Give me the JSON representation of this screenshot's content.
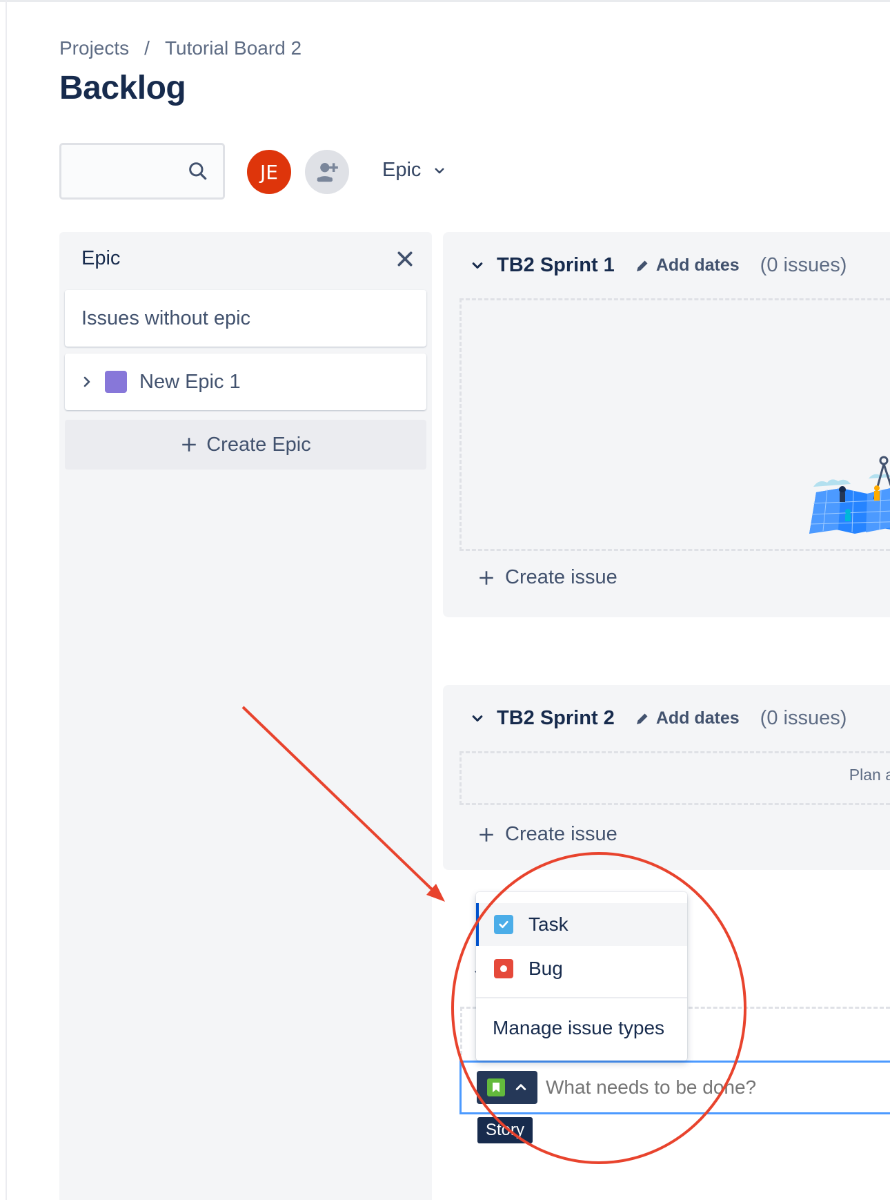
{
  "breadcrumb": {
    "items": [
      "Projects",
      "Tutorial Board 2"
    ],
    "separator": "/"
  },
  "page": {
    "title": "Backlog"
  },
  "toolbar": {
    "search_placeholder": "",
    "avatar_initials": "JE",
    "avatar_color": "#de350b",
    "add_people_icon": "add-user-icon",
    "filter_label": "Epic"
  },
  "epic_panel": {
    "title": "Epic",
    "issues_without_epic": "Issues without epic",
    "epics": [
      {
        "label": "New Epic 1",
        "color": "#8777d9"
      }
    ],
    "create_label": "Create Epic"
  },
  "sprints": [
    {
      "name": "TB2 Sprint 1",
      "add_dates": "Add dates",
      "count": "(0 issues)",
      "create_issue": "Create issue"
    },
    {
      "name": "TB2 Sprint 2",
      "add_dates": "Add dates",
      "count": "(0 issues)",
      "plan_text": "Plan a",
      "create_issue": "Create issue"
    }
  ],
  "issue_type_menu": {
    "items": [
      {
        "label": "Task",
        "icon": "task-checkbox-icon",
        "color": "#4bade8",
        "selected": true
      },
      {
        "label": "Bug",
        "icon": "bug-icon",
        "color": "#e5493a"
      }
    ],
    "manage_label": "Manage issue types"
  },
  "new_issue": {
    "placeholder": "What needs to be done?",
    "type_icon": "story-bookmark-icon",
    "type_color": "#63ba3c",
    "tooltip": "Story"
  },
  "annotation": {
    "color": "#e8432d"
  }
}
